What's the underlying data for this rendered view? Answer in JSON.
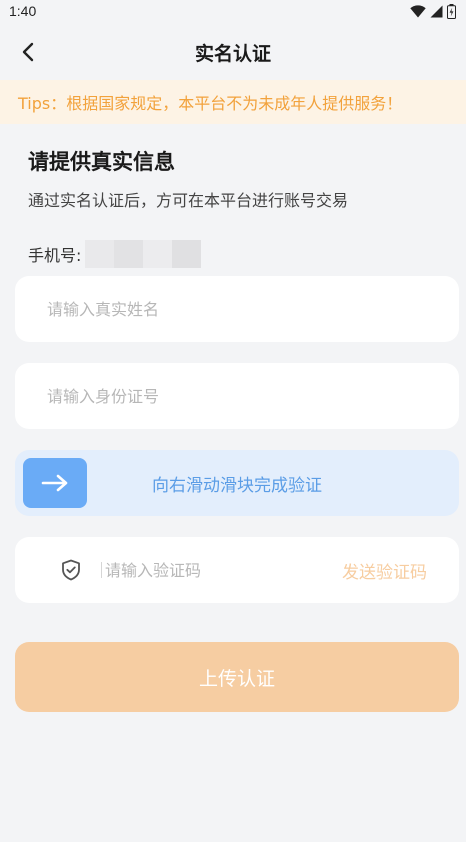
{
  "status_bar": {
    "time": "1:40",
    "icons": [
      "wifi-icon",
      "cell-signal-icon",
      "battery-icon"
    ]
  },
  "nav": {
    "back_icon": "chevron-left-icon",
    "title": "实名认证"
  },
  "tips": {
    "text": "Tips：根据国家规定，本平台不为未成年人提供服务！",
    "color": "#f2a23c"
  },
  "form_header": {
    "title": "请提供真实信息",
    "subtitle": "通过实名认证后，方可在本平台进行账号交易"
  },
  "phone": {
    "label": "手机号:",
    "masked": true
  },
  "fields": {
    "name": {
      "value": "",
      "placeholder": "请输入真实姓名"
    },
    "id_number": {
      "value": "",
      "placeholder": "请输入身份证号"
    }
  },
  "slider": {
    "icon": "arrow-right-icon",
    "text": "向右滑动滑块完成验证",
    "progress": 0,
    "colors": {
      "track": "#e3eefc",
      "knob": "#6aabf6",
      "text": "#5b9de6"
    }
  },
  "verification": {
    "icon": "shield-check-icon",
    "value": "",
    "placeholder": "请输入验证码",
    "send_label": "发送验证码"
  },
  "submit": {
    "label": "上传认证",
    "color": "#f6cda2"
  }
}
